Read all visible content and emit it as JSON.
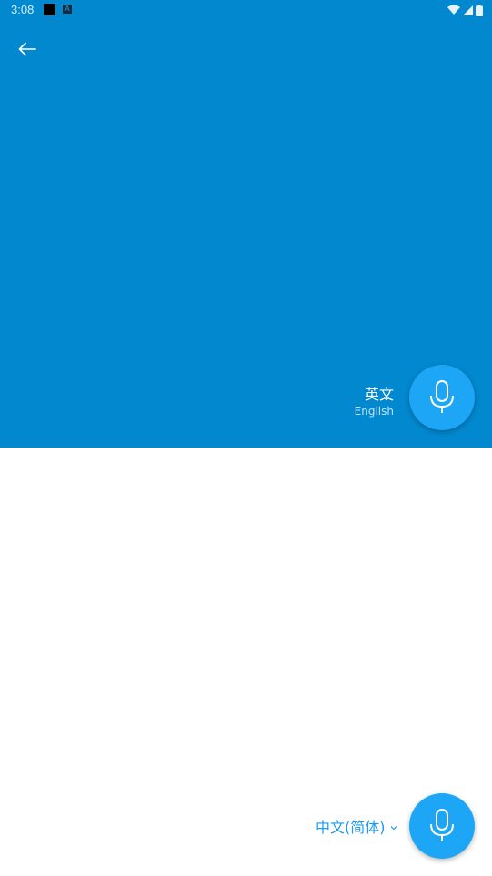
{
  "status_bar": {
    "time": "3:08",
    "notification_badge": "A",
    "icons": [
      "wifi-icon",
      "cellular-signal-icon",
      "battery-icon"
    ]
  },
  "toolbar": {
    "back_icon": "arrow-left-icon"
  },
  "source_panel": {
    "background_color": "#0288cf",
    "language_native": "英文",
    "language_english": "English",
    "mic_icon": "microphone-icon",
    "mic_color": "#1ea6f6"
  },
  "target_panel": {
    "background_color": "#ffffff",
    "language_label": "中文(简体)",
    "label_color": "#1a9bef",
    "mic_icon": "microphone-icon",
    "mic_color": "#1ea6f6"
  }
}
